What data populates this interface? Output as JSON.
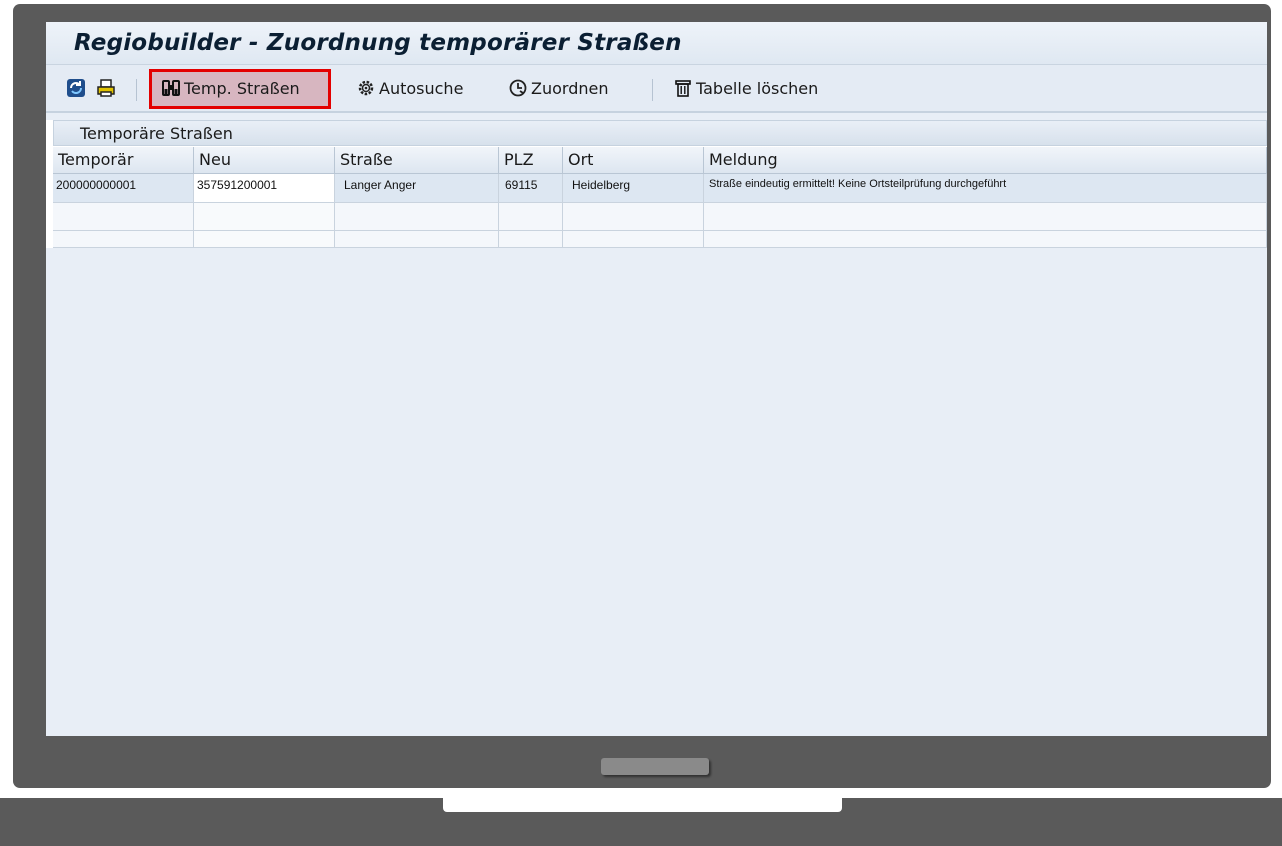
{
  "window": {
    "title": "Regiobuilder - Zuordnung temporärer Straßen"
  },
  "toolbar": {
    "refresh_icon": "refresh-icon",
    "print_icon": "print-icon",
    "temp_strassen_label": "Temp. Straßen",
    "autosuche_label": "Autosuche",
    "zuordnen_label": "Zuordnen",
    "tabelle_loeschen_label": "Tabelle löschen",
    "highlighted_button": "Temp. Straßen"
  },
  "table": {
    "title": "Temporäre Straßen",
    "columns": [
      "Temporär",
      "Neu",
      "Straße",
      "PLZ",
      "Ort",
      "Meldung"
    ],
    "rows": [
      {
        "temporaer": "200000000001",
        "neu": "357591200001",
        "strasse": "Langer Anger",
        "plz": "69115",
        "ort": "Heidelberg",
        "meldung": "Straße eindeutig ermittelt! Keine Ortsteilprüfung durchgeführt"
      }
    ]
  },
  "colors": {
    "highlight_border": "#e30000",
    "screen_background": "#e8eef6",
    "device_frame": "#5a5a5a"
  }
}
